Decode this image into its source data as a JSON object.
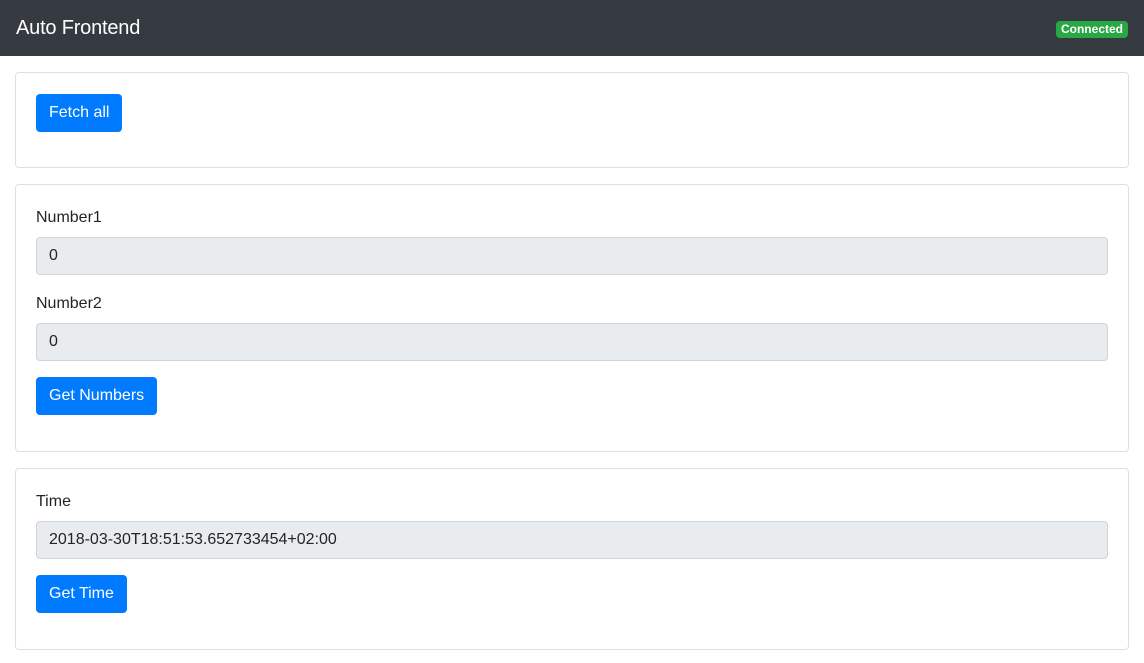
{
  "header": {
    "title": "Auto Frontend",
    "status": "Connected",
    "status_color": "#28a745",
    "background_color": "#343a40"
  },
  "accent_color": "#007bff",
  "fetch_card": {
    "button_label": "Fetch all"
  },
  "numbers_card": {
    "number1_label": "Number1",
    "number1_value": "0",
    "number2_label": "Number2",
    "number2_value": "0",
    "button_label": "Get Numbers"
  },
  "time_card": {
    "time_label": "Time",
    "time_value": "2018-03-30T18:51:53.652733454+02:00",
    "button_label": "Get Time"
  }
}
